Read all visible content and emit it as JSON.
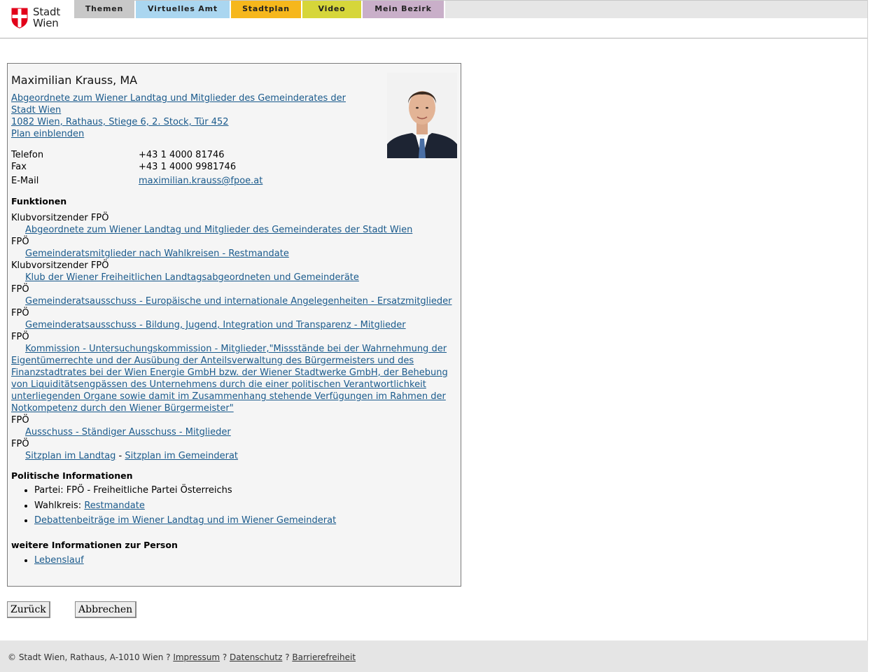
{
  "header": {
    "logo_line1": "Stadt",
    "logo_line2": "Wien",
    "nav": [
      {
        "label": "Themen",
        "color": "#c8c8c8"
      },
      {
        "label": "Virtuelles Amt",
        "color": "#aad6f0"
      },
      {
        "label": "Stadtplan",
        "color": "#f6b71c"
      },
      {
        "label": "Video",
        "color": "#d6d63a"
      },
      {
        "label": "Mein Bezirk",
        "color": "#c9afc9"
      }
    ]
  },
  "person": {
    "name": "Maximilian Krauss, MA",
    "group_link": "Abgeordnete zum Wiener Landtag und Mitglieder des Gemeinderates der Stadt Wien ",
    "address_link": "1082 Wien, Rathaus, Stiege 6, 2. Stock, Tür 452",
    "plan_link": "Plan einblenden",
    "contact": [
      {
        "label": "Telefon",
        "value": "+43 1 4000 81746"
      },
      {
        "label": "Fax",
        "value": "+43 1 4000 9981746"
      },
      {
        "label": "E-Mail",
        "value": "maximilian.krauss@fpoe.at"
      }
    ]
  },
  "functions": {
    "heading": "Funktionen",
    "items": [
      {
        "role": "Klubvorsitzender FPÖ",
        "link": "Abgeordnete zum Wiener Landtag und Mitglieder des Gemeinderates der Stadt Wien"
      },
      {
        "role": "FPÖ",
        "link": "Gemeinderatsmitglieder nach Wahlkreisen - Restmandate"
      },
      {
        "role": "Klubvorsitzender FPÖ",
        "link": "Klub der Wiener Freiheitlichen Landtagsabgeordneten und Gemeinderäte"
      },
      {
        "role": "FPÖ",
        "link": "Gemeinderatsausschuss - Europäische und internationale Angelegenheiten - Ersatzmitglieder"
      },
      {
        "role": "FPÖ",
        "link": "Gemeinderatsausschuss - Bildung, Jugend, Integration und Transparenz - Mitglieder"
      },
      {
        "role": "FPÖ",
        "link": "Kommission - Untersuchungskommission - Mitglieder,\"Missstände bei der Wahrnehmung der Eigentümerrechte und der Ausübung der Anteilsverwaltung des Bürgermeisters und des Finanzstadtrates bei der Wien Energie GmbH bzw. der Wiener Stadtwerke GmbH, der Behebung von Liquiditätsengpässen des Unternehmens durch die einer politischen Verantwortlichkeit unterliegenden Organe sowie damit im Zusammenhang stehende Verfügungen im Rahmen der Notkompetenz durch den Wiener Bürgermeister\""
      },
      {
        "role": "FPÖ",
        "link": "Ausschuss - Ständiger Ausschuss - Mitglieder"
      },
      {
        "role": "FPÖ",
        "link": "Sitzplan im Landtag",
        "separator": " - ",
        "link2": "Sitzplan im Gemeinderat"
      }
    ]
  },
  "political": {
    "heading": "Politische Informationen",
    "party": "Partei: FPÖ - Freiheitliche Partei Österreichs",
    "constituency_label": "Wahlkreis: ",
    "constituency_link": "Restmandate",
    "debate_link": "Debattenbeiträge im Wiener Landtag und im Wiener Gemeinderat"
  },
  "further": {
    "heading": "weitere Informationen zur Person",
    "cv_link": "Lebenslauf"
  },
  "buttons": {
    "back": "Zurück",
    "cancel": "Abbrechen"
  },
  "footer": {
    "copyright": "© Stadt Wien, Rathaus, A-1010 Wien",
    "sep": " ? ",
    "impressum": "Impressum",
    "datenschutz": "Datenschutz",
    "barrierefreiheit": "Barrierefreiheit"
  }
}
